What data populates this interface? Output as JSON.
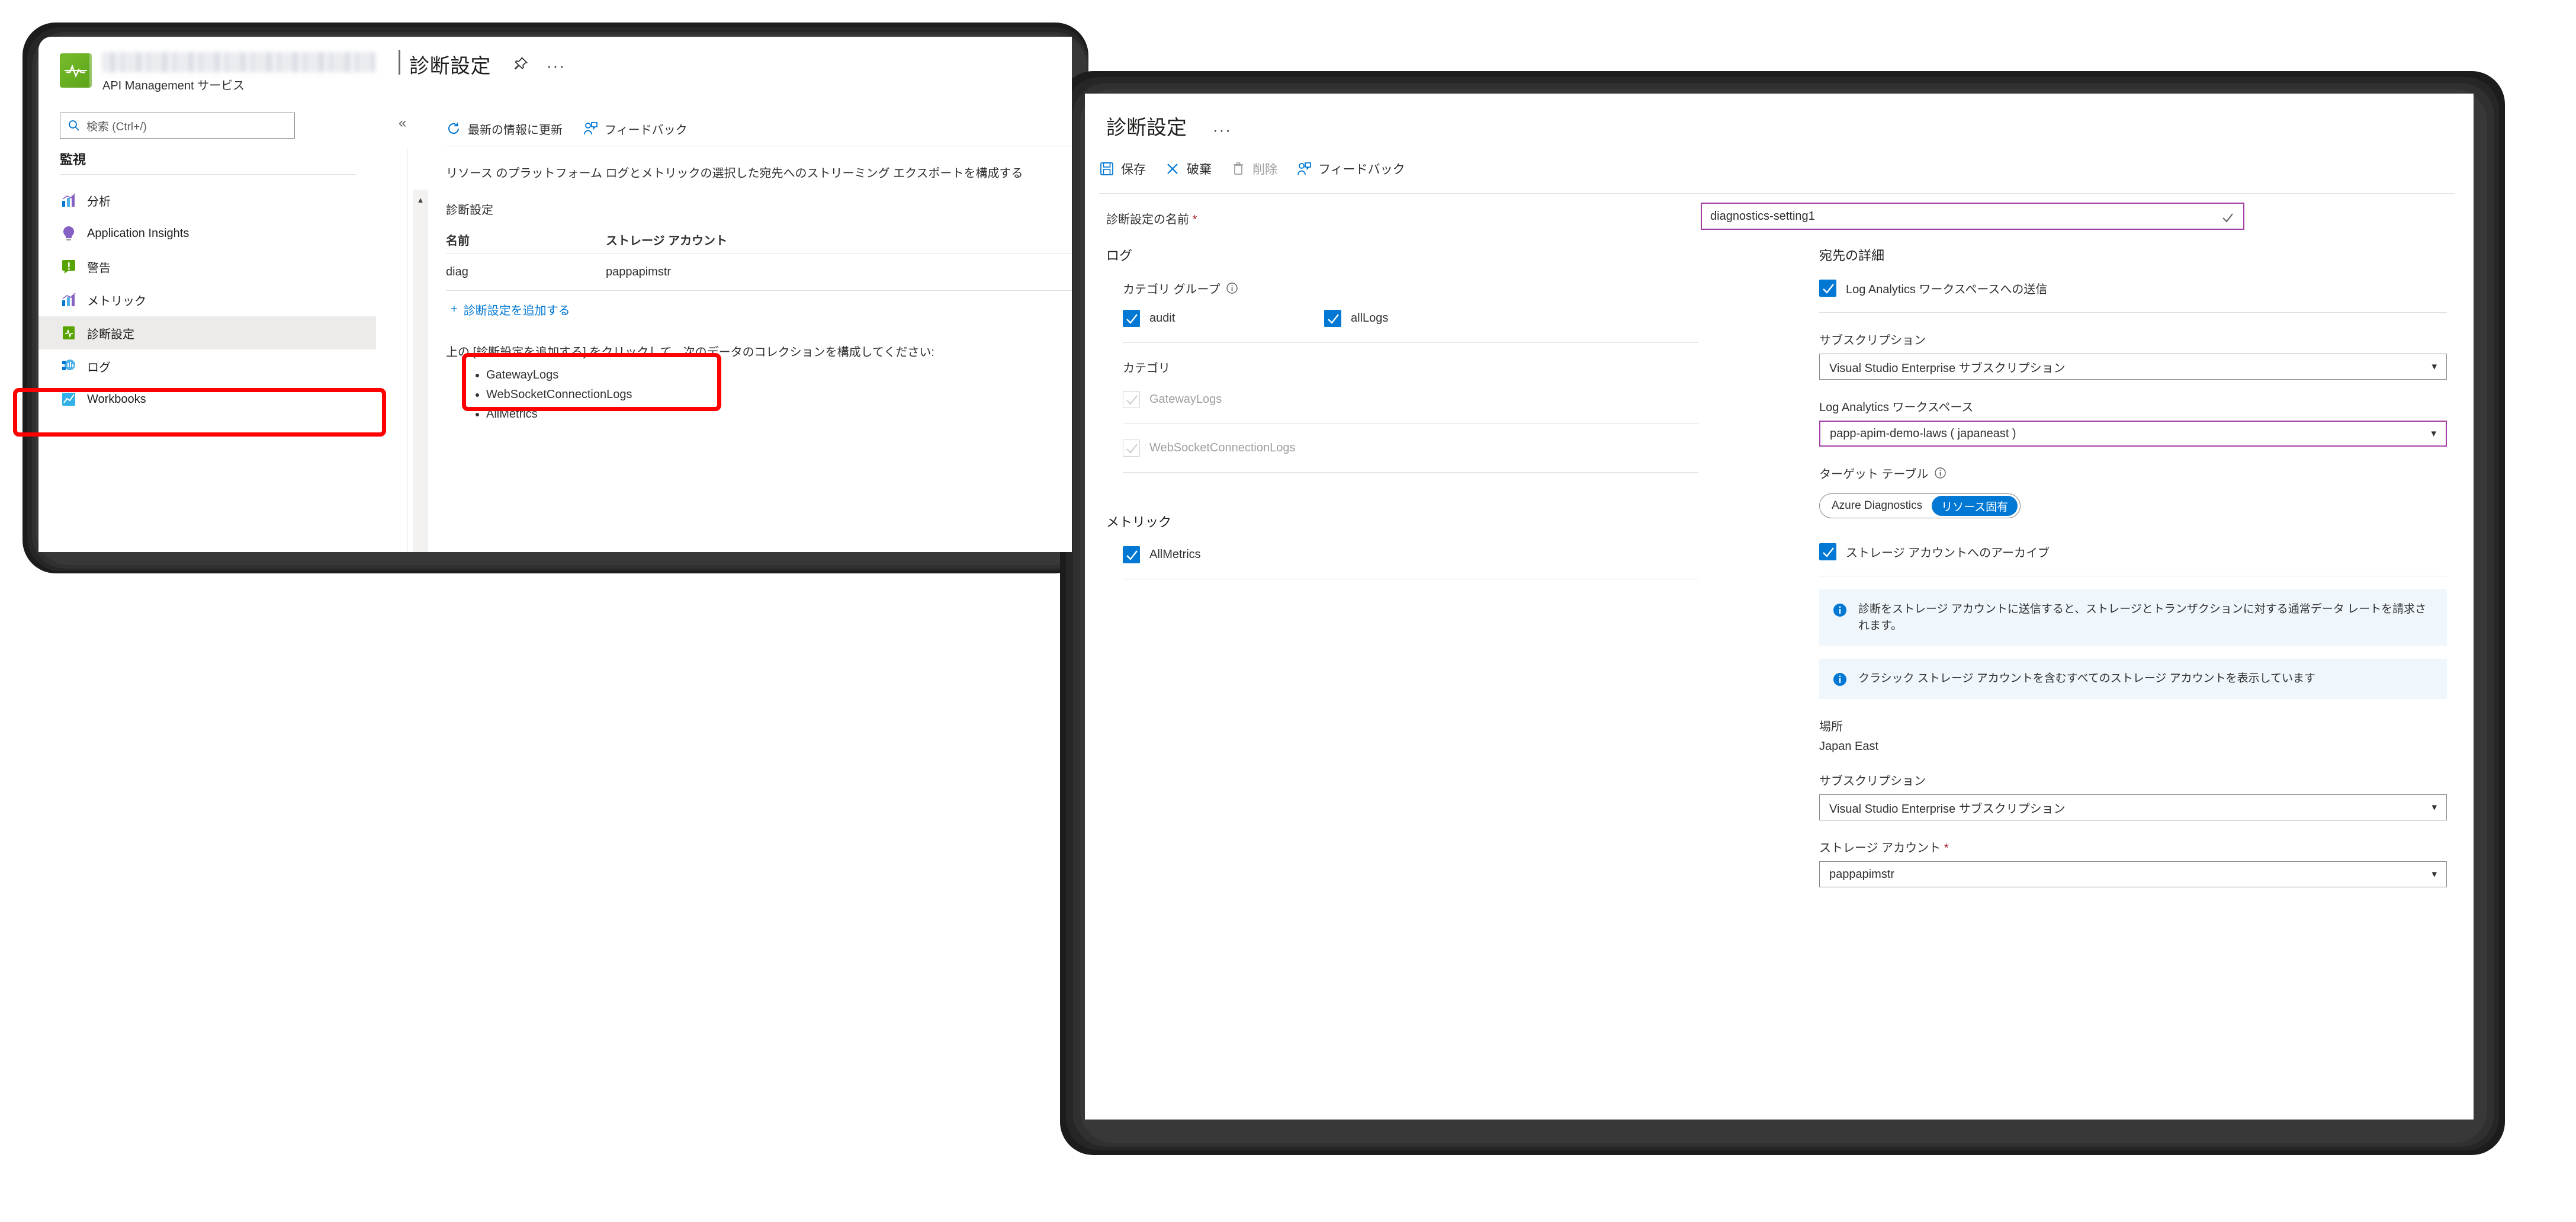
{
  "background_blade": {
    "resource_subtitle": "API Management サービス",
    "title": "診断設定",
    "pin_icon": "pin-icon",
    "more_icon": "ellipsis-icon",
    "search": {
      "placeholder": "検索 (Ctrl+/)",
      "value": "",
      "icon": "search-icon"
    },
    "collapse_icon": "chevron-double-left-icon",
    "nav": {
      "group_title": "監視",
      "items": [
        {
          "label": "分析",
          "icon": "analytics-chart-icon",
          "active": false
        },
        {
          "label": "Application Insights",
          "icon": "lightbulb-icon",
          "active": false
        },
        {
          "label": "警告",
          "icon": "alert-icon",
          "active": false
        },
        {
          "label": "メトリック",
          "icon": "metrics-chart-icon",
          "active": false
        },
        {
          "label": "診断設定",
          "icon": "diagnostic-book-icon",
          "active": true
        },
        {
          "label": "ログ",
          "icon": "logs-icon",
          "active": false
        },
        {
          "label": "Workbooks",
          "icon": "workbooks-icon",
          "active": false
        }
      ]
    },
    "toolbar": [
      {
        "label": "最新の情報に更新",
        "icon": "refresh-icon"
      },
      {
        "label": "フィードバック",
        "icon": "feedback-person-icon"
      }
    ],
    "description": "リソース のプラットフォーム ログとメトリックの選択した宛先へのストリーミング エクスポートを構成する",
    "section_label": "診断設定",
    "table": {
      "columns": [
        "名前",
        "ストレージ アカウント"
      ],
      "rows": [
        {
          "name": "diag",
          "storage_account": "pappapimstr"
        }
      ]
    },
    "add_link": {
      "label": "診断設定を追加する",
      "icon": "plus-icon"
    },
    "hint": "上の [診断設定を追加する] をクリックして、次のデータのコレクションを構成してください:",
    "data_collection_items": [
      "GatewayLogs",
      "WebSocketConnectionLogs",
      "AllMetrics"
    ]
  },
  "dialog": {
    "title": "診断設定",
    "more_icon": "ellipsis-icon",
    "toolbar": [
      {
        "label": "保存",
        "icon": "save-icon",
        "disabled": false
      },
      {
        "label": "破棄",
        "icon": "discard-x-icon",
        "disabled": false
      },
      {
        "label": "削除",
        "icon": "trash-icon",
        "disabled": true
      },
      {
        "label": "フィードバック",
        "icon": "feedback-person-icon",
        "disabled": false
      }
    ],
    "name_field": {
      "label": "診断設定の名前",
      "required_marker": "*",
      "value": "diagnostics-setting1",
      "validation_icon": "checkmark-icon"
    },
    "logs": {
      "section_title": "ログ",
      "category_group_label": "カテゴリ グループ",
      "category_group_info_icon": "info-circle-icon",
      "category_groups": [
        {
          "label": "audit",
          "checked": true,
          "disabled": false
        },
        {
          "label": "allLogs",
          "checked": true,
          "disabled": false
        }
      ],
      "category_label": "カテゴリ",
      "categories": [
        {
          "label": "GatewayLogs",
          "checked": true,
          "disabled": true
        },
        {
          "label": "WebSocketConnectionLogs",
          "checked": true,
          "disabled": true
        }
      ]
    },
    "metrics": {
      "section_title": "メトリック",
      "items": [
        {
          "label": "AllMetrics",
          "checked": true,
          "disabled": false
        }
      ]
    },
    "destination": {
      "section_title": "宛先の詳細",
      "log_analytics": {
        "checkbox_label": "Log Analytics ワークスペースへの送信",
        "checked": true,
        "subscription_label": "サブスクリプション",
        "subscription_value": "Visual Studio Enterprise サブスクリプション",
        "workspace_label": "Log Analytics ワークスペース",
        "workspace_value": "papp-apim-demo-laws ( japaneast )",
        "target_table_label": "ターゲット テーブル",
        "target_table_info_icon": "info-circle-icon",
        "target_table_options": [
          "Azure Diagnostics",
          "リソース固有"
        ],
        "target_table_selected": "リソース固有"
      },
      "storage": {
        "checkbox_label": "ストレージ アカウントへのアーカイブ",
        "checked": true,
        "banner_1": "診断をストレージ アカウントに送信すると、ストレージとトランザクションに対する通常データ レートを請求されます。",
        "banner_2": "クラシック ストレージ アカウントを含むすべてのストレージ アカウントを表示しています",
        "banner_icon": "info-circle-filled-icon",
        "location_label": "場所",
        "location_value": "Japan East",
        "subscription_label": "サブスクリプション",
        "subscription_value": "Visual Studio Enterprise サブスクリプション",
        "storage_account_label": "ストレージ アカウント",
        "storage_account_required": "*",
        "storage_account_value": "pappapimstr"
      }
    }
  },
  "annotations": {
    "accent_red": "#ff0000",
    "accent_blue": "#0078d4",
    "accent_purple": "#a33ea3"
  }
}
